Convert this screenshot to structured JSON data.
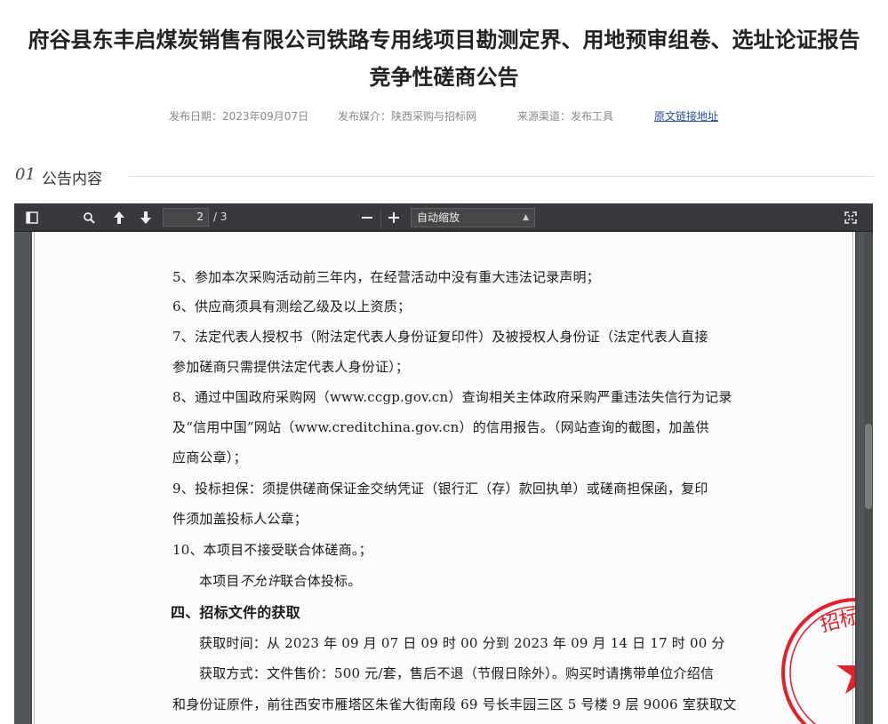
{
  "header": {
    "title_line1": "府谷县东丰启煤炭销售有限公司铁路专用线项目勘测定界、用地预审组卷、选址论证报告",
    "title_line2": "竞争性磋商公告",
    "publish_date": "发布日期：2023年09月07日",
    "media": "发布媒介：陕西采购与招标网",
    "channel": "来源渠道：发布工具",
    "source_link": "原文链接地址"
  },
  "section": {
    "number": "01",
    "label": "公告内容"
  },
  "viewer": {
    "toolbar": {
      "page_number": "2",
      "page_total": "/ 3",
      "zoom_label": "自动缩放",
      "icons": [
        "sidebar-toggle-icon",
        "search-icon",
        "arrow-up-icon",
        "arrow-down-icon",
        "zoom-out-icon",
        "zoom-in-icon",
        "fullscreen-icon"
      ]
    },
    "document": {
      "lines": [
        "5、参加本次采购活动前三年内，在经营活动中没有重大违法记录声明；",
        "6、供应商须具有测绘乙级及以上资质；",
        "7、法定代表人授权书（附法定代表人身份证复印件）及被授权人身份证（法定代表人直接",
        "参加磋商只需提供法定代表人身份证）；",
        "8、通过中国政府采购网（www.ccgp.gov.cn）查询相关主体政府采购严重违法失信行为记录",
        "及“信用中国”网站（www.creditchina.gov.cn）的信用报告。（网站查询的截图，加盖供",
        "应商公章）；",
        "9、投标担保：须提供磋商保证金交纳凭证（银行汇（存）款回执单）或磋商担保函，复印",
        "件须加盖投标人公章；",
        "10、本项目不接受联合体磋商。；"
      ],
      "line_10b_prefix": "本项目",
      "line_10b_italic": "不允许",
      "line_10b_suffix": "联合体投标。",
      "heading": "四、招标文件的获取",
      "acquire_time": "获取时间：从 2023 年 09 月 07 日  09 时 00 分到 2023 年 09 月 14 日  17 时 00 分",
      "acquire_method": "获取方式：文件售价：500 元/套，售后不退（节假日除外）。购买时请携带单位介绍信",
      "acquire_method_cont": "和身份证原件，前往西安市雁塔区朱雀大街南段 69 号长丰园三区 5 号楼 9 层 9006 室获取文",
      "stamp_text": "招标有"
    }
  },
  "colors": {
    "toolbar": "#38383d",
    "viewer_bg": "#525659",
    "stamp_red": "#e0202a",
    "link": "#2a4d9c"
  }
}
